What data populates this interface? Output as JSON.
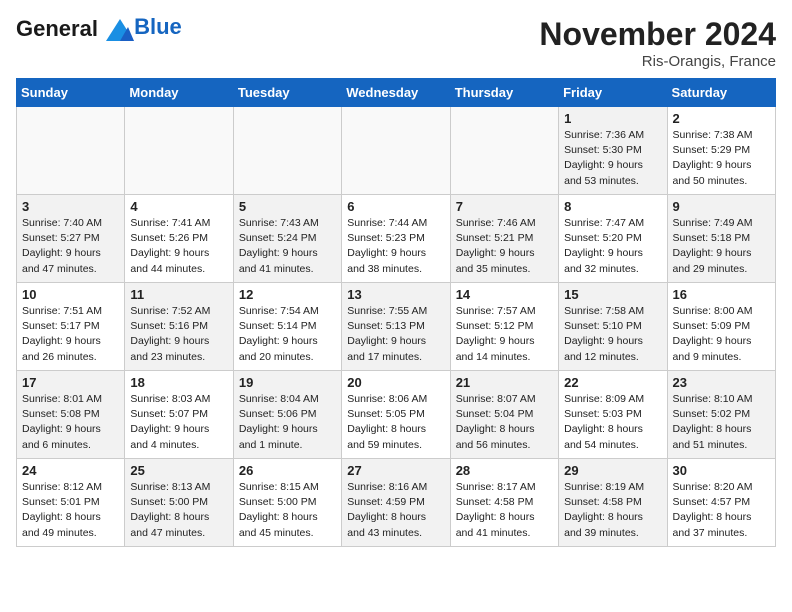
{
  "header": {
    "logo_line1": "General",
    "logo_line2": "Blue",
    "month": "November 2024",
    "location": "Ris-Orangis, France"
  },
  "weekdays": [
    "Sunday",
    "Monday",
    "Tuesday",
    "Wednesday",
    "Thursday",
    "Friday",
    "Saturday"
  ],
  "weeks": [
    [
      {
        "day": "",
        "info": "",
        "empty": true
      },
      {
        "day": "",
        "info": "",
        "empty": true
      },
      {
        "day": "",
        "info": "",
        "empty": true
      },
      {
        "day": "",
        "info": "",
        "empty": true
      },
      {
        "day": "",
        "info": "",
        "empty": true
      },
      {
        "day": "1",
        "info": "Sunrise: 7:36 AM\nSunset: 5:30 PM\nDaylight: 9 hours\nand 53 minutes.",
        "shaded": true
      },
      {
        "day": "2",
        "info": "Sunrise: 7:38 AM\nSunset: 5:29 PM\nDaylight: 9 hours\nand 50 minutes.",
        "shaded": false
      }
    ],
    [
      {
        "day": "3",
        "info": "Sunrise: 7:40 AM\nSunset: 5:27 PM\nDaylight: 9 hours\nand 47 minutes.",
        "shaded": true
      },
      {
        "day": "4",
        "info": "Sunrise: 7:41 AM\nSunset: 5:26 PM\nDaylight: 9 hours\nand 44 minutes.",
        "shaded": false
      },
      {
        "day": "5",
        "info": "Sunrise: 7:43 AM\nSunset: 5:24 PM\nDaylight: 9 hours\nand 41 minutes.",
        "shaded": true
      },
      {
        "day": "6",
        "info": "Sunrise: 7:44 AM\nSunset: 5:23 PM\nDaylight: 9 hours\nand 38 minutes.",
        "shaded": false
      },
      {
        "day": "7",
        "info": "Sunrise: 7:46 AM\nSunset: 5:21 PM\nDaylight: 9 hours\nand 35 minutes.",
        "shaded": true
      },
      {
        "day": "8",
        "info": "Sunrise: 7:47 AM\nSunset: 5:20 PM\nDaylight: 9 hours\nand 32 minutes.",
        "shaded": false
      },
      {
        "day": "9",
        "info": "Sunrise: 7:49 AM\nSunset: 5:18 PM\nDaylight: 9 hours\nand 29 minutes.",
        "shaded": true
      }
    ],
    [
      {
        "day": "10",
        "info": "Sunrise: 7:51 AM\nSunset: 5:17 PM\nDaylight: 9 hours\nand 26 minutes.",
        "shaded": false
      },
      {
        "day": "11",
        "info": "Sunrise: 7:52 AM\nSunset: 5:16 PM\nDaylight: 9 hours\nand 23 minutes.",
        "shaded": true
      },
      {
        "day": "12",
        "info": "Sunrise: 7:54 AM\nSunset: 5:14 PM\nDaylight: 9 hours\nand 20 minutes.",
        "shaded": false
      },
      {
        "day": "13",
        "info": "Sunrise: 7:55 AM\nSunset: 5:13 PM\nDaylight: 9 hours\nand 17 minutes.",
        "shaded": true
      },
      {
        "day": "14",
        "info": "Sunrise: 7:57 AM\nSunset: 5:12 PM\nDaylight: 9 hours\nand 14 minutes.",
        "shaded": false
      },
      {
        "day": "15",
        "info": "Sunrise: 7:58 AM\nSunset: 5:10 PM\nDaylight: 9 hours\nand 12 minutes.",
        "shaded": true
      },
      {
        "day": "16",
        "info": "Sunrise: 8:00 AM\nSunset: 5:09 PM\nDaylight: 9 hours\nand 9 minutes.",
        "shaded": false
      }
    ],
    [
      {
        "day": "17",
        "info": "Sunrise: 8:01 AM\nSunset: 5:08 PM\nDaylight: 9 hours\nand 6 minutes.",
        "shaded": true
      },
      {
        "day": "18",
        "info": "Sunrise: 8:03 AM\nSunset: 5:07 PM\nDaylight: 9 hours\nand 4 minutes.",
        "shaded": false
      },
      {
        "day": "19",
        "info": "Sunrise: 8:04 AM\nSunset: 5:06 PM\nDaylight: 9 hours\nand 1 minute.",
        "shaded": true
      },
      {
        "day": "20",
        "info": "Sunrise: 8:06 AM\nSunset: 5:05 PM\nDaylight: 8 hours\nand 59 minutes.",
        "shaded": false
      },
      {
        "day": "21",
        "info": "Sunrise: 8:07 AM\nSunset: 5:04 PM\nDaylight: 8 hours\nand 56 minutes.",
        "shaded": true
      },
      {
        "day": "22",
        "info": "Sunrise: 8:09 AM\nSunset: 5:03 PM\nDaylight: 8 hours\nand 54 minutes.",
        "shaded": false
      },
      {
        "day": "23",
        "info": "Sunrise: 8:10 AM\nSunset: 5:02 PM\nDaylight: 8 hours\nand 51 minutes.",
        "shaded": true
      }
    ],
    [
      {
        "day": "24",
        "info": "Sunrise: 8:12 AM\nSunset: 5:01 PM\nDaylight: 8 hours\nand 49 minutes.",
        "shaded": false
      },
      {
        "day": "25",
        "info": "Sunrise: 8:13 AM\nSunset: 5:00 PM\nDaylight: 8 hours\nand 47 minutes.",
        "shaded": true
      },
      {
        "day": "26",
        "info": "Sunrise: 8:15 AM\nSunset: 5:00 PM\nDaylight: 8 hours\nand 45 minutes.",
        "shaded": false
      },
      {
        "day": "27",
        "info": "Sunrise: 8:16 AM\nSunset: 4:59 PM\nDaylight: 8 hours\nand 43 minutes.",
        "shaded": true
      },
      {
        "day": "28",
        "info": "Sunrise: 8:17 AM\nSunset: 4:58 PM\nDaylight: 8 hours\nand 41 minutes.",
        "shaded": false
      },
      {
        "day": "29",
        "info": "Sunrise: 8:19 AM\nSunset: 4:58 PM\nDaylight: 8 hours\nand 39 minutes.",
        "shaded": true
      },
      {
        "day": "30",
        "info": "Sunrise: 8:20 AM\nSunset: 4:57 PM\nDaylight: 8 hours\nand 37 minutes.",
        "shaded": false
      }
    ]
  ]
}
